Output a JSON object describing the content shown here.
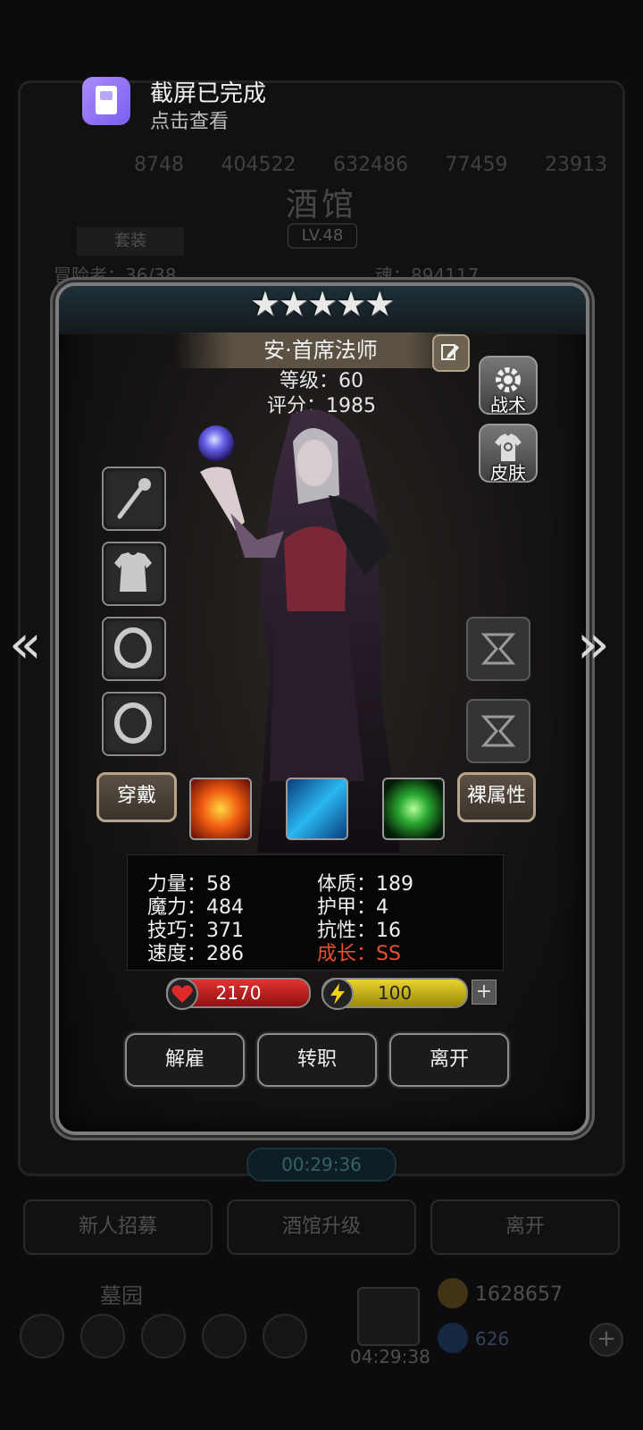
{
  "notification": {
    "title": "截屏已完成",
    "subtitle": "点击查看"
  },
  "background": {
    "resources": [
      "8748",
      "404522",
      "632486",
      "77459",
      "23913"
    ],
    "title": "酒馆",
    "level_badge": "LV.48",
    "tab_label": "套装",
    "capacity_text": "冒险者：36/38",
    "soul_text": "魂：894117",
    "timer": "00:29:36",
    "buttons": [
      "新人招募",
      "酒馆升级",
      "离开"
    ],
    "bottom_label": "墓园",
    "gift_timer": "04:29:38",
    "gold": "1628657",
    "gems": "626"
  },
  "hero": {
    "stars": "★★★★★",
    "name": "安·首席法师",
    "level_line": "等级：60",
    "score_line": "评分：1985"
  },
  "side_buttons": {
    "tactics": "战术",
    "skin": "皮肤"
  },
  "actions": {
    "wear": "穿戴",
    "bare_attributes": "裸属性"
  },
  "stats": {
    "strength": "力量：58",
    "constitution": "体质：189",
    "magic": "魔力：484",
    "armor": "护甲：4",
    "skill": "技巧：371",
    "resistance": "抗性：16",
    "speed": "速度：286",
    "growth": "成长：SS"
  },
  "bars": {
    "hp": "2170",
    "energy": "100"
  },
  "bottom_buttons": {
    "dismiss": "解雇",
    "transfer": "转职",
    "leave": "离开"
  },
  "colors": {
    "growth_red": "#e8502d",
    "hp_red": "#c81e1e",
    "energy_yellow": "#d8c21e",
    "button_gold_border": "#b7a48a"
  }
}
